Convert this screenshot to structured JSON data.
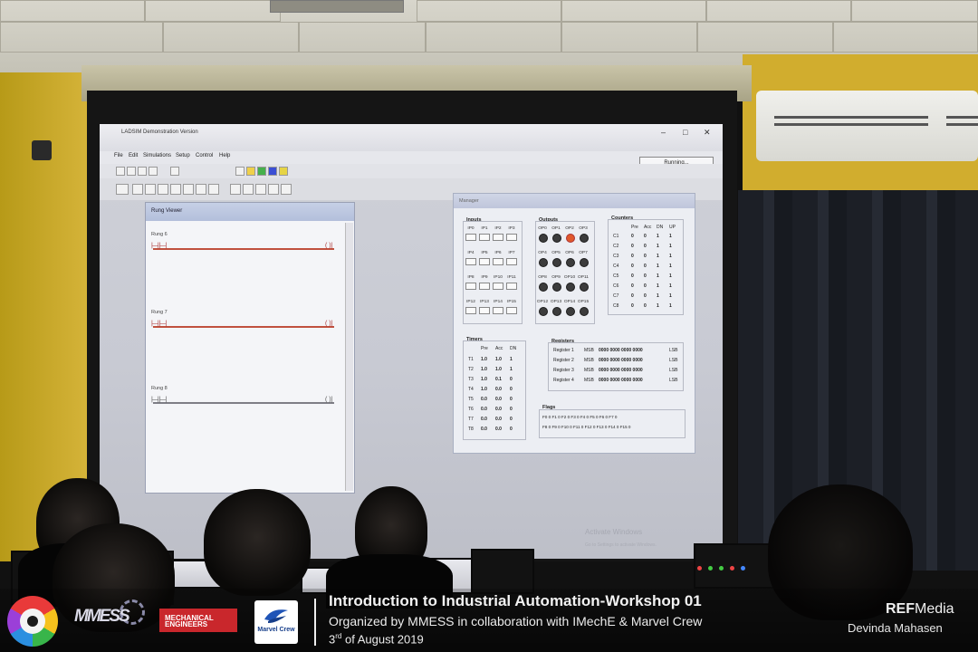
{
  "screen_app": {
    "window_title": "LADSIM Demonstration Version",
    "menu": [
      "File",
      "Edit",
      "Simulations",
      "Setup",
      "Control",
      "Help"
    ],
    "status_button": "Running...",
    "watermark_title": "Activate Windows",
    "watermark_sub": "Go to Settings to activate Windows.",
    "rung_viewer": {
      "title": "Rung Viewer",
      "rungs": [
        "Rung 6",
        "Rung 7",
        "Rung 8"
      ]
    },
    "manager": {
      "title": "Manager",
      "inputs_title": "Inputs",
      "inputs": [
        "IP0",
        "IP1",
        "IP2",
        "IP3",
        "IP4",
        "IP5",
        "IP6",
        "IP7",
        "IP8",
        "IP9",
        "IP10",
        "IP11",
        "IP12",
        "IP13",
        "IP14",
        "IP15"
      ],
      "outputs_title": "Outputs",
      "outputs": [
        "OP0",
        "OP1",
        "OP2",
        "OP3",
        "OP4",
        "OP5",
        "OP6",
        "OP7",
        "OP8",
        "OP9",
        "OP10",
        "OP11",
        "OP12",
        "OP13",
        "OP14",
        "OP15"
      ],
      "outputs_on": [
        2
      ],
      "counters_title": "Counters",
      "counter_headers": [
        "Pre",
        "Acc",
        "DN",
        "UP"
      ],
      "counters": [
        [
          "C1",
          "0",
          "0",
          "1",
          "1"
        ],
        [
          "C2",
          "0",
          "0",
          "1",
          "1"
        ],
        [
          "C3",
          "0",
          "0",
          "1",
          "1"
        ],
        [
          "C4",
          "0",
          "0",
          "1",
          "1"
        ],
        [
          "C5",
          "0",
          "0",
          "1",
          "1"
        ],
        [
          "C6",
          "0",
          "0",
          "1",
          "1"
        ],
        [
          "C7",
          "0",
          "0",
          "1",
          "1"
        ],
        [
          "C8",
          "0",
          "0",
          "1",
          "1"
        ]
      ],
      "timers_title": "Timers",
      "timer_headers": [
        "Pre",
        "Acc",
        "DN"
      ],
      "timers": [
        [
          "T1",
          "1.0",
          "1.0",
          "1"
        ],
        [
          "T2",
          "1.0",
          "1.0",
          "1"
        ],
        [
          "T3",
          "1.0",
          "0.1",
          "0"
        ],
        [
          "T4",
          "1.0",
          "0.0",
          "0"
        ],
        [
          "T5",
          "0.0",
          "0.0",
          "0"
        ],
        [
          "T6",
          "0.0",
          "0.0",
          "0"
        ],
        [
          "T7",
          "0.0",
          "0.0",
          "0"
        ],
        [
          "T8",
          "0.0",
          "0.0",
          "0"
        ]
      ],
      "registers_title": "Registers",
      "registers": [
        {
          "name": "Register 1",
          "msb": "MSB",
          "bits": "0000 0000 0000 0000",
          "lsb": "LSB"
        },
        {
          "name": "Register 2",
          "msb": "MSB",
          "bits": "0000 0000 0000 0000",
          "lsb": "LSB"
        },
        {
          "name": "Register 3",
          "msb": "MSB",
          "bits": "0000 0000 0000 0000",
          "lsb": "LSB"
        },
        {
          "name": "Register 4",
          "msb": "MSB",
          "bits": "0000 0000 0000 0000",
          "lsb": "LSB"
        }
      ],
      "flags_title": "Flags",
      "flags_row1": "F0 0  F1 0  F2 0  F3 0  F4 0  F5 0  F6 0  F7 0",
      "flags_row2": "F8 0  F9 0  F10 0  F11 0  F12 0  F13 0  F14 0  F15 0"
    }
  },
  "banner": {
    "headline": "Introduction to Industrial Automation-Workshop 01",
    "subline": "Organized by MMESS in collaboration with IMechE & Marvel Crew",
    "date_day": "3",
    "date_suffix": "rd",
    "date_rest": " of August 2019",
    "credit_brand_bold": "REF",
    "credit_brand_rest": "Media",
    "credit_name": "Devinda Mahasen"
  },
  "logos": {
    "mmess": "MMESS",
    "imeche_line1": "MECHANICAL",
    "imeche_line2": "ENGINEERS",
    "marvel": "Marvel Crew"
  },
  "colors": {
    "output_on": "#e0582c",
    "rung_active": "#c0503e",
    "imeche_red": "#c9272c",
    "marvel_blue": "#163e8a"
  }
}
